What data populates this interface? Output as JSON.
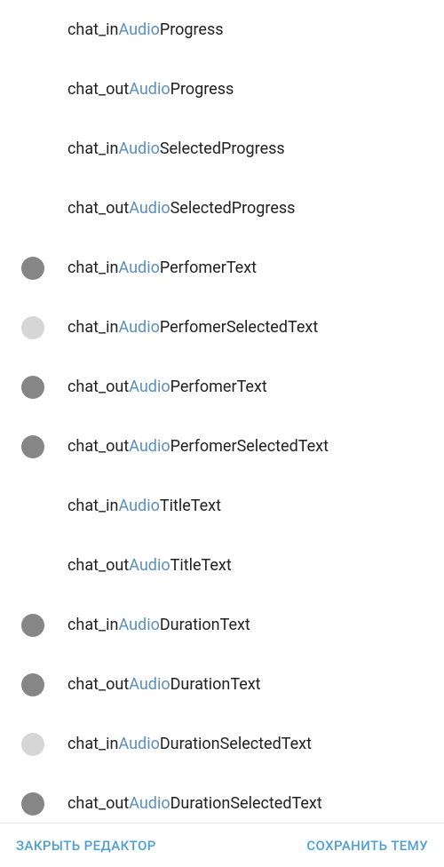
{
  "highlight_term": "Audio",
  "items": [
    {
      "prefix": "chat_in",
      "suffix": "Progress",
      "swatch": null
    },
    {
      "prefix": "chat_out",
      "suffix": "Progress",
      "swatch": null
    },
    {
      "prefix": "chat_in",
      "suffix": "SelectedProgress",
      "swatch": null
    },
    {
      "prefix": "chat_out",
      "suffix": "SelectedProgress",
      "swatch": null
    },
    {
      "prefix": "chat_in",
      "suffix": "PerfomerText",
      "swatch": "#868686"
    },
    {
      "prefix": "chat_in",
      "suffix": "PerfomerSelectedText",
      "swatch": "#d6d6d6"
    },
    {
      "prefix": "chat_out",
      "suffix": "PerfomerText",
      "swatch": "#868686"
    },
    {
      "prefix": "chat_out",
      "suffix": "PerfomerSelectedText",
      "swatch": "#868686"
    },
    {
      "prefix": "chat_in",
      "suffix": "TitleText",
      "swatch": null
    },
    {
      "prefix": "chat_out",
      "suffix": "TitleText",
      "swatch": null
    },
    {
      "prefix": "chat_in",
      "suffix": "DurationText",
      "swatch": "#868686"
    },
    {
      "prefix": "chat_out",
      "suffix": "DurationText",
      "swatch": "#868686"
    },
    {
      "prefix": "chat_in",
      "suffix": "DurationSelectedText",
      "swatch": "#d6d6d6"
    },
    {
      "prefix": "chat_out",
      "suffix": "DurationSelectedText",
      "swatch": "#868686"
    }
  ],
  "footer": {
    "close_label": "ЗАКРЫТЬ РЕДАКТОР",
    "save_label": "СОХРАНИТЬ ТЕМУ"
  }
}
